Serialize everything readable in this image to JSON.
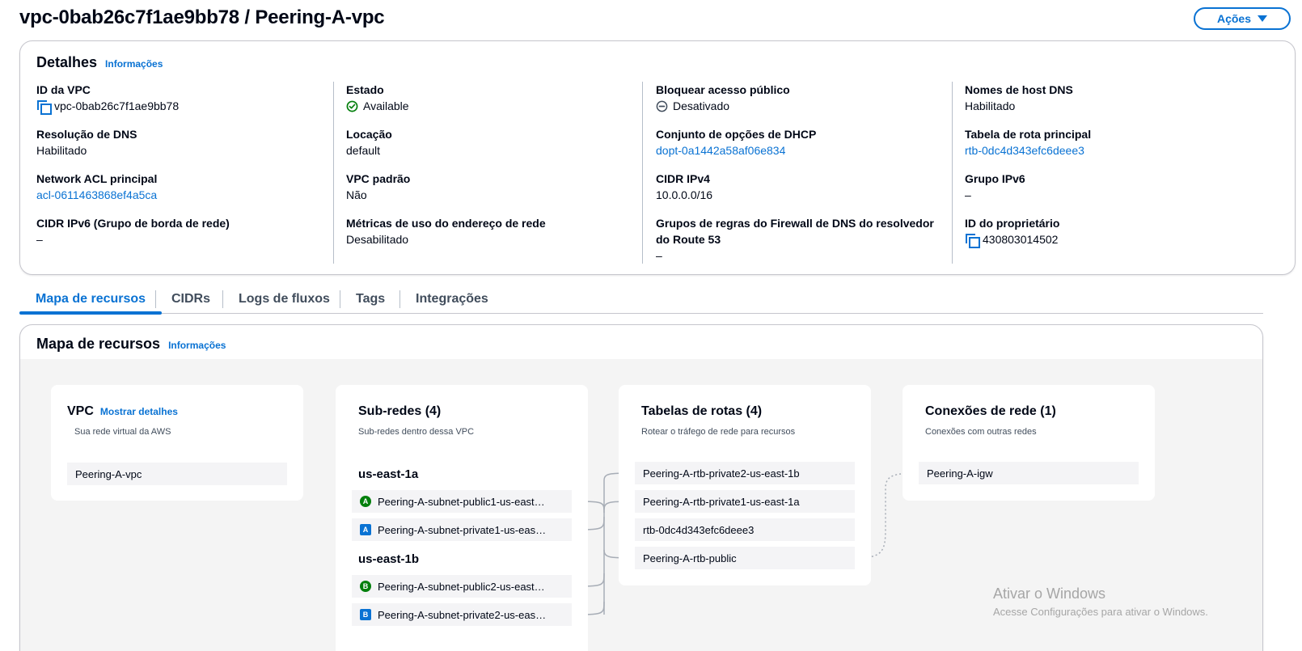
{
  "header": {
    "title": "vpc-0bab26c7f1ae9bb78 / Peering-A-vpc",
    "actions_label": "Ações"
  },
  "details": {
    "title": "Detalhes",
    "info_link": "Informações",
    "fields": {
      "vpc_id": {
        "label": "ID da VPC",
        "value": "vpc-0bab26c7f1ae9bb78"
      },
      "state": {
        "label": "Estado",
        "value": "Available"
      },
      "block_public": {
        "label": "Bloquear acesso público",
        "value": "Desativado"
      },
      "dns_hostnames": {
        "label": "Nomes de host DNS",
        "value": "Habilitado"
      },
      "dns_resolution": {
        "label": "Resolução de DNS",
        "value": "Habilitado"
      },
      "tenancy": {
        "label": "Locação",
        "value": "default"
      },
      "dhcp_options": {
        "label": "Conjunto de opções de DHCP",
        "value": "dopt-0a1442a58af06e834"
      },
      "main_route_table": {
        "label": "Tabela de rota principal",
        "value": "rtb-0dc4d343efc6deee3"
      },
      "main_acl": {
        "label": "Network ACL principal",
        "value": "acl-0611463868ef4a5ca"
      },
      "default_vpc": {
        "label": "VPC padrão",
        "value": "Não"
      },
      "cidr_ipv4": {
        "label": "CIDR IPv4",
        "value": "10.0.0.0/16"
      },
      "ipv6_pool": {
        "label": "Grupo IPv6",
        "value": "–"
      },
      "ipv6_border": {
        "label": "CIDR IPv6 (Grupo de borda de rede)",
        "value": "–"
      },
      "network_metrics": {
        "label": "Métricas de uso do endereço de rede",
        "value": "Desabilitado"
      },
      "dns_firewall": {
        "label": "Grupos de regras do Firewall de DNS do resolvedor do Route 53",
        "value": "–"
      },
      "owner_id": {
        "label": "ID do proprietário",
        "value": "430803014502"
      }
    },
    "colors": {
      "link": "#0972d3",
      "available": "#037f0c"
    }
  },
  "tabs": [
    "Mapa de recursos",
    "CIDRs",
    "Logs de fluxos",
    "Tags",
    "Integrações"
  ],
  "resource_map": {
    "title": "Mapa de recursos",
    "info_link": "Informações",
    "vpc": {
      "title": "VPC",
      "show_details": "Mostrar detalhes",
      "desc": "Sua rede virtual da AWS",
      "items": [
        "Peering-A-vpc"
      ]
    },
    "subnets": {
      "title": "Sub-redes (4)",
      "desc": "Sub-redes dentro dessa VPC",
      "zones": [
        {
          "name": "us-east-1a",
          "items": [
            {
              "badge": "A",
              "kind": "public",
              "label": "Peering-A-subnet-public1-us-east…"
            },
            {
              "badge": "A",
              "kind": "private",
              "label": "Peering-A-subnet-private1-us-eas…"
            }
          ]
        },
        {
          "name": "us-east-1b",
          "items": [
            {
              "badge": "B",
              "kind": "public",
              "label": "Peering-A-subnet-public2-us-east…"
            },
            {
              "badge": "B",
              "kind": "private",
              "label": "Peering-A-subnet-private2-us-eas…"
            }
          ]
        }
      ]
    },
    "route_tables": {
      "title": "Tabelas de rotas (4)",
      "desc": "Rotear o tráfego de rede para recursos",
      "items": [
        "Peering-A-rtb-private2-us-east-1b",
        "Peering-A-rtb-private1-us-east-1a",
        "rtb-0dc4d343efc6deee3",
        "Peering-A-rtb-public"
      ]
    },
    "network_connections": {
      "title": "Conexões de rede (1)",
      "desc": "Conexões com outras redes",
      "items": [
        "Peering-A-igw"
      ]
    }
  },
  "watermark": {
    "title": "Ativar o Windows",
    "subtitle": "Acesse Configurações para ativar o Windows."
  }
}
